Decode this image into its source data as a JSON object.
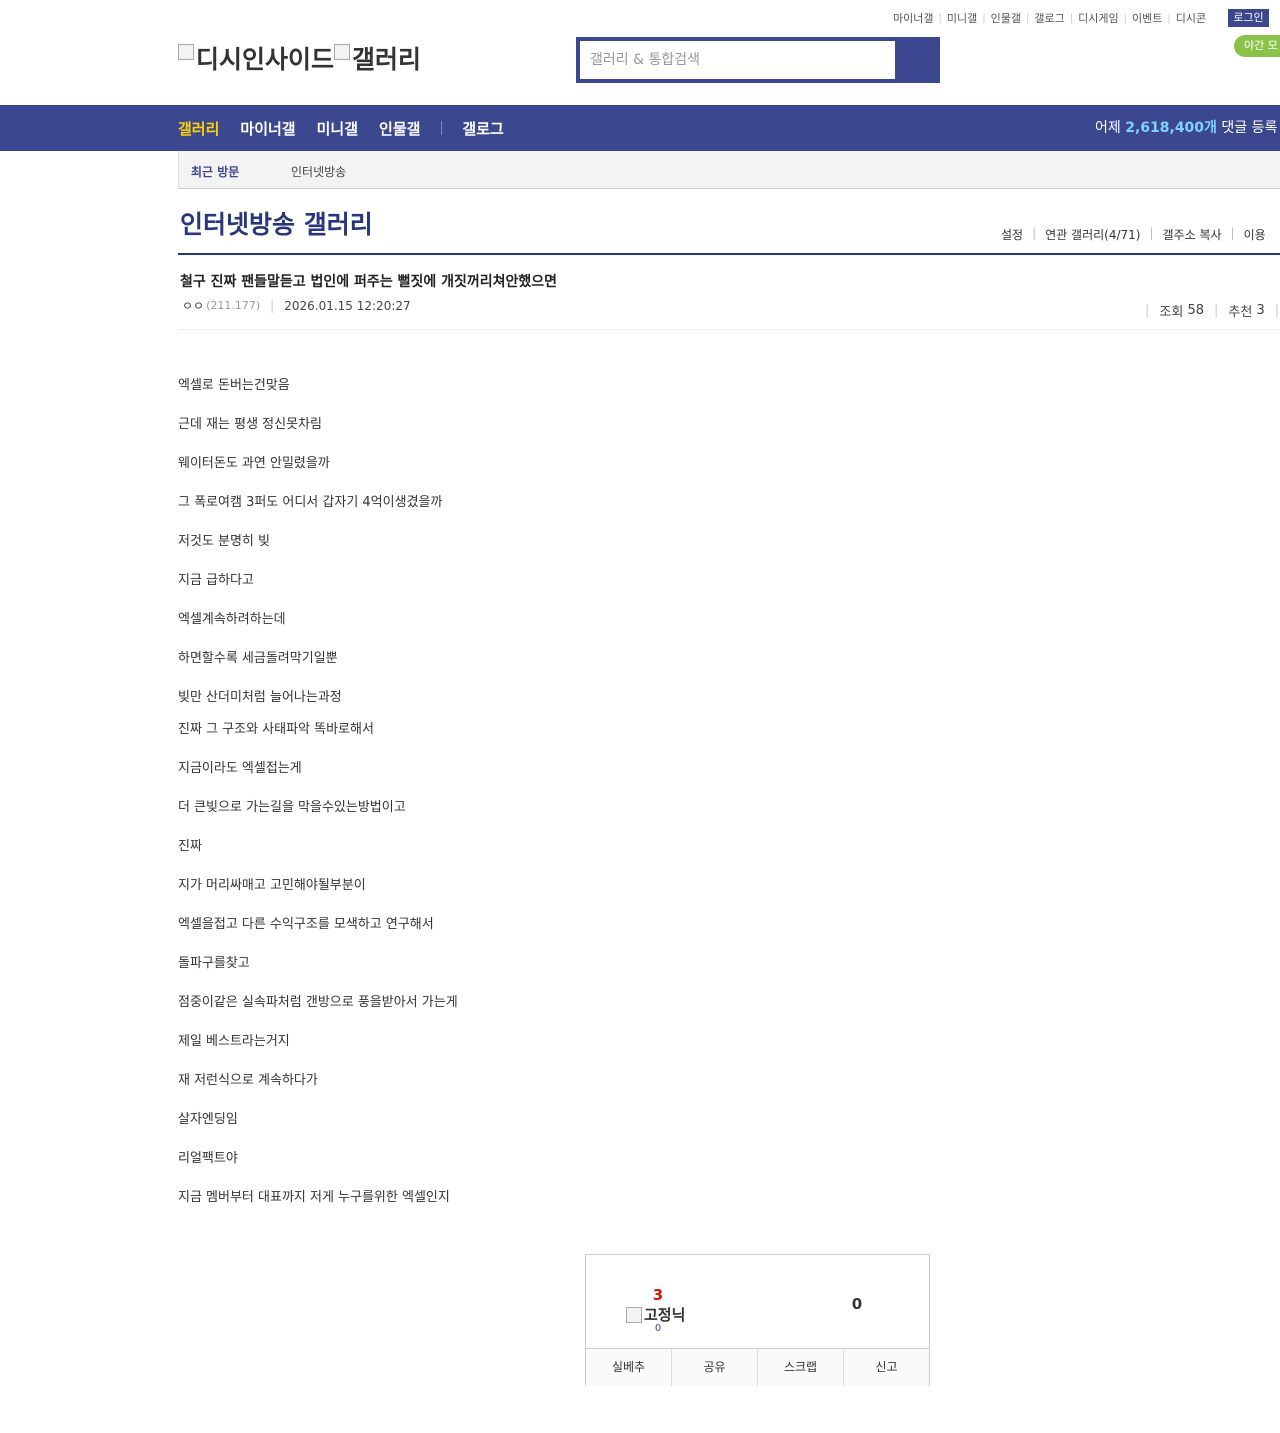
{
  "util_links": [
    "마이너갤",
    "미니갤",
    "인물갤",
    "갤로그",
    "디시게임",
    "이벤트",
    "디시콘"
  ],
  "login": "로그인",
  "night_mode": "야간 모",
  "logo": {
    "site": "디시인사이드",
    "section": "갤러리"
  },
  "search": {
    "placeholder": "갤러리 & 통합검색"
  },
  "gnb": {
    "items": [
      "갤러리",
      "마이너갤",
      "미니갤",
      "인물갤",
      "갤로그"
    ],
    "stat_prefix": "어제",
    "stat_value": "2,618,400개",
    "stat_suffix": "댓글 등록"
  },
  "recent": {
    "title": "최근 방문",
    "gallery": "인터넷방송"
  },
  "gallery": {
    "title": "인터넷방송 갤러리",
    "menu": [
      "설정",
      "연관 갤러리(4/71)",
      "갤주소 복사",
      "이용"
    ]
  },
  "post": {
    "title": "철구 진짜 팬들말듣고 법인에 퍼주는 뻘짓에 개짓꺼리쳐안했으면",
    "author": "ㅇㅇ",
    "ip": "(211.177)",
    "date": "2026.01.15 12:20:27",
    "views_label": "조회",
    "views": "58",
    "recommend_label": "추천",
    "recommend": "3",
    "lines": [
      "엑셀로 돈버는건맞음",
      "근데 재는 평생 정신못차림",
      "웨이터돈도 과연 안밀렸을까",
      "그 폭로여캠 3퍼도 어디서 갑자기 4억이생겼을까",
      "저것도 분명히 빚",
      "지금 급하다고",
      "엑셀계속하려하는데",
      "하면할수록 세금돌려막기일뿐",
      "빚만 산더미처럼 늘어나는과정",
      "진짜 그 구조와 사태파악 똑바로해서",
      "지금이라도 엑셀접는게",
      "더 큰빚으로 가는길을 막을수있는방법이고",
      "진짜",
      "지가 머리싸매고 고민해야될부분이",
      "엑셀을접고 다른 수익구조를 모색하고 연구해서",
      "돌파구를찾고",
      "점중이같은 실속파처럼 갠방으로 풍을받아서 가는게",
      "제일 베스트라는거지",
      "재 저런식으로 계속하다가",
      "살자엔딩임",
      "리얼팩트야",
      "지금 멤버부터 대표까지 저게 누구를위한 엑셀인지"
    ]
  },
  "recommend_box": {
    "up_count": "3",
    "fixed_label": "고정닉",
    "fixed_count": "0",
    "down_count": "0",
    "buttons": [
      "실베추",
      "공유",
      "스크랩",
      "신고"
    ]
  }
}
